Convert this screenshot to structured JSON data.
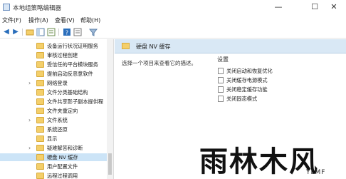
{
  "window": {
    "title": "本地组策略编辑器",
    "minimize_glyph": "—",
    "maximize_glyph": "☐",
    "close_glyph": "✕"
  },
  "menu": [
    "文件(F)",
    "操作(A)",
    "查看(V)",
    "帮助(H)"
  ],
  "toolbar": {
    "back_icon": "arrow-left-icon",
    "forward_icon": "arrow-right-icon",
    "up_icon": "folder-up-icon",
    "show_hide_tree_icon": "tree-toggle-icon",
    "export_icon": "export-list-icon",
    "help_icon": "help-icon",
    "properties_icon": "properties-icon",
    "filter_icon": "filter-icon"
  },
  "tree": {
    "items": [
      {
        "label": "设备运行状况证明服务",
        "expandable": false
      },
      {
        "label": "审核过程创建",
        "expandable": false
      },
      {
        "label": "受信任的平台模块服务",
        "expandable": false
      },
      {
        "label": "提前启动反恶意软件",
        "expandable": false
      },
      {
        "label": "网络登录",
        "expandable": true
      },
      {
        "label": "文件分类基础结构",
        "expandable": false
      },
      {
        "label": "文件共享影子副本提供程",
        "expandable": false
      },
      {
        "label": "文件夹重定向",
        "expandable": false
      },
      {
        "label": "文件系统",
        "expandable": true
      },
      {
        "label": "系统还原",
        "expandable": false
      },
      {
        "label": "显示",
        "expandable": false
      },
      {
        "label": "疑难解答和诊断",
        "expandable": true
      },
      {
        "label": "硬盘 NV 缓存",
        "expandable": false,
        "selected": true
      },
      {
        "label": "用户配置文件",
        "expandable": false
      },
      {
        "label": "远程过程调用",
        "expandable": false
      }
    ]
  },
  "content": {
    "header_title": "硬盘 NV 缓存",
    "description": "选择一个项目来查看它的描述。",
    "settings_header": "设置",
    "settings": [
      "关闭启动和恢复优化",
      "关闭缓存电源模式",
      "关闭稳定缓存功能",
      "关闭固态模式"
    ]
  },
  "watermark": {
    "big": "雨林木风",
    "small": "YLMF"
  }
}
